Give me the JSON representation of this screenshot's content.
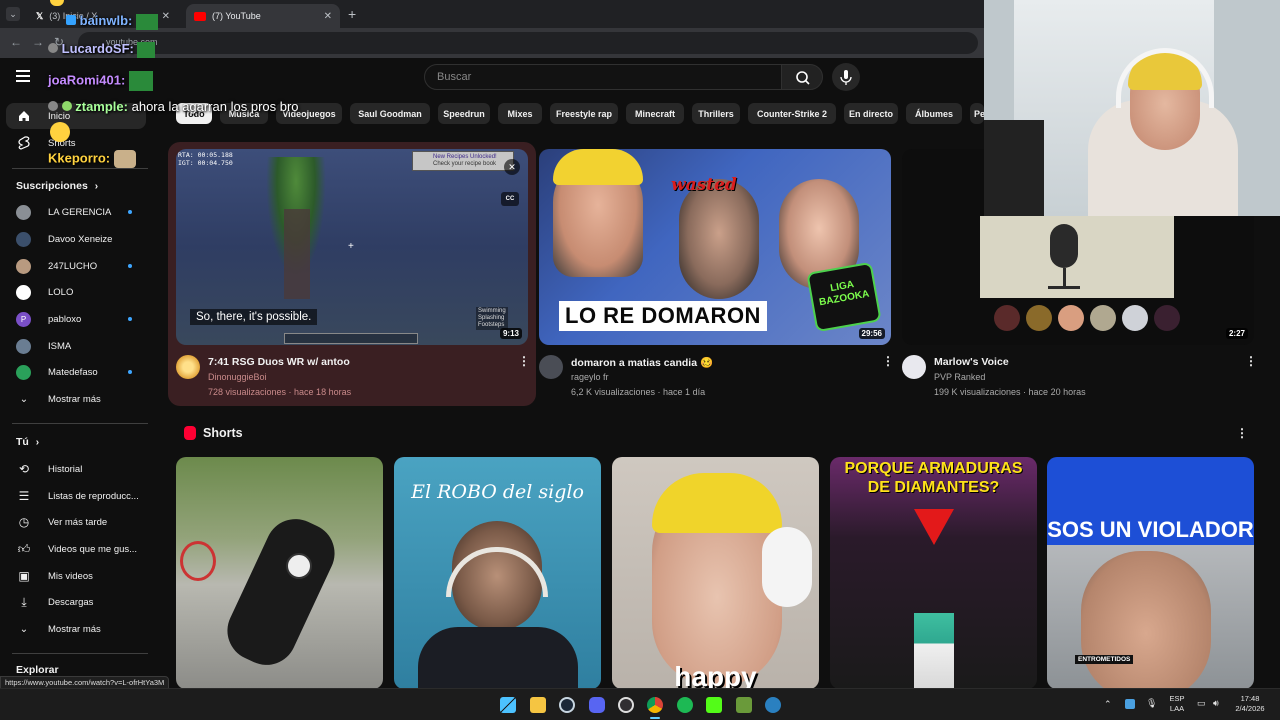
{
  "browser": {
    "tabs": [
      {
        "title": "(3) Inicio / X",
        "active": false
      },
      {
        "title": "(7) YouTube",
        "active": true
      }
    ],
    "new_tab": "+",
    "url": "youtube.com",
    "status_url": "https://www.youtube.com/watch?v=L-ofrHtYa3M"
  },
  "header": {
    "search_placeholder": "Buscar"
  },
  "sidebar": {
    "main": [
      {
        "label": "Inicio",
        "icon": "home-icon"
      },
      {
        "label": "Shorts",
        "icon": "shorts-icon"
      }
    ],
    "subscriptions_title": "Suscripciones",
    "subscriptions": [
      {
        "label": "LA GERENCIA",
        "dot": true,
        "color": "#8a8f95"
      },
      {
        "label": "Davoo Xeneize",
        "dot": false,
        "color": "#3b4f6b"
      },
      {
        "label": "247LUCHO",
        "dot": true,
        "color": "#b89a80"
      },
      {
        "label": "LOLO",
        "dot": false,
        "color": "#ffffff"
      },
      {
        "label": "pabloxo",
        "dot": true,
        "color": "#7a4fc7",
        "initial": "P"
      },
      {
        "label": "ISMA",
        "dot": false,
        "color": "#6a7d92"
      },
      {
        "label": "Matedefaso",
        "dot": true,
        "color": "#2aa05a"
      }
    ],
    "show_more": "Mostrar más",
    "you_title": "Tú",
    "you_items": [
      {
        "label": "Historial",
        "icon": "history-icon"
      },
      {
        "label": "Listas de reproducc...",
        "icon": "playlists-icon"
      },
      {
        "label": "Ver más tarde",
        "icon": "watch-later-icon"
      },
      {
        "label": "Videos que me gus...",
        "icon": "liked-icon"
      },
      {
        "label": "Mis videos",
        "icon": "my-videos-icon"
      },
      {
        "label": "Descargas",
        "icon": "downloads-icon"
      }
    ],
    "you_show_more": "Mostrar más",
    "explore_title": "Explorar"
  },
  "chips": [
    "Todo",
    "Música",
    "Videojuegos",
    "Saul Goodman",
    "Speedrun",
    "Mixes",
    "Freestyle rap",
    "Minecraft",
    "Thrillers",
    "Counter-Strike 2",
    "En directo",
    "Álbumes",
    "Pe"
  ],
  "videos": [
    {
      "title": "7:41 RSG Duos WR w/ antoo",
      "channel": "DinonuggieBoi",
      "meta": "728 visualizaciones · hace 18 horas",
      "duration": "9:13",
      "caption": "So, there, it's possible.",
      "hud_line1": "RTA: 00:05.188",
      "hud_line2": "IGT: 00:04.750",
      "toast_line1": "New Recipes Unlocked!",
      "toast_line2": "Check your recipe book",
      "subtitle_line1": "Swimming",
      "subtitle_line2": "Splashing",
      "subtitle_line3": "Footsteps",
      "cc": "CC"
    },
    {
      "title": "domaron a matias candia 🥴",
      "channel": "rageylo fr",
      "meta": "6,2 K visualizaciones · hace 1 día",
      "duration": "29:56",
      "thumb_text": "LO RE DOMARON",
      "thumb_tag": "wasted",
      "thumb_logo_line1": "LIGA",
      "thumb_logo_line2": "BAZOOKA"
    },
    {
      "title": "Marlow's Voice",
      "channel": "PVP Ranked",
      "meta": "199 K visualizaciones · hace 20 horas",
      "duration": "2:27"
    }
  ],
  "shorts": {
    "title": "Shorts",
    "items": [
      {
        "text": ""
      },
      {
        "text": "El ROBO del siglo"
      },
      {
        "text": "happy"
      },
      {
        "text": "PORQUE ARMADURAS DE DIAMANTES?"
      },
      {
        "text": "SOS UN VIOLADOR",
        "tag": "ENTROMETIDOS"
      }
    ]
  },
  "chat": [
    {
      "user": "bainwlb:",
      "message": "",
      "color": "#7fb3ff"
    },
    {
      "user": "LucardoSF:",
      "message": "",
      "color": "#c0c0ff"
    },
    {
      "user": "joaRomi401:",
      "message": "",
      "color": "#c58cff"
    },
    {
      "user": "ztample:",
      "message": "ahora la agarran los pros bro",
      "color": "#a8ff9a"
    },
    {
      "user": "Kkeporro:",
      "message": "",
      "color": "#ffd23f"
    }
  ],
  "taskbar": {
    "lang_line1": "ESP",
    "lang_line2": "LAA",
    "time": "17:48",
    "date": "2/4/2026"
  }
}
